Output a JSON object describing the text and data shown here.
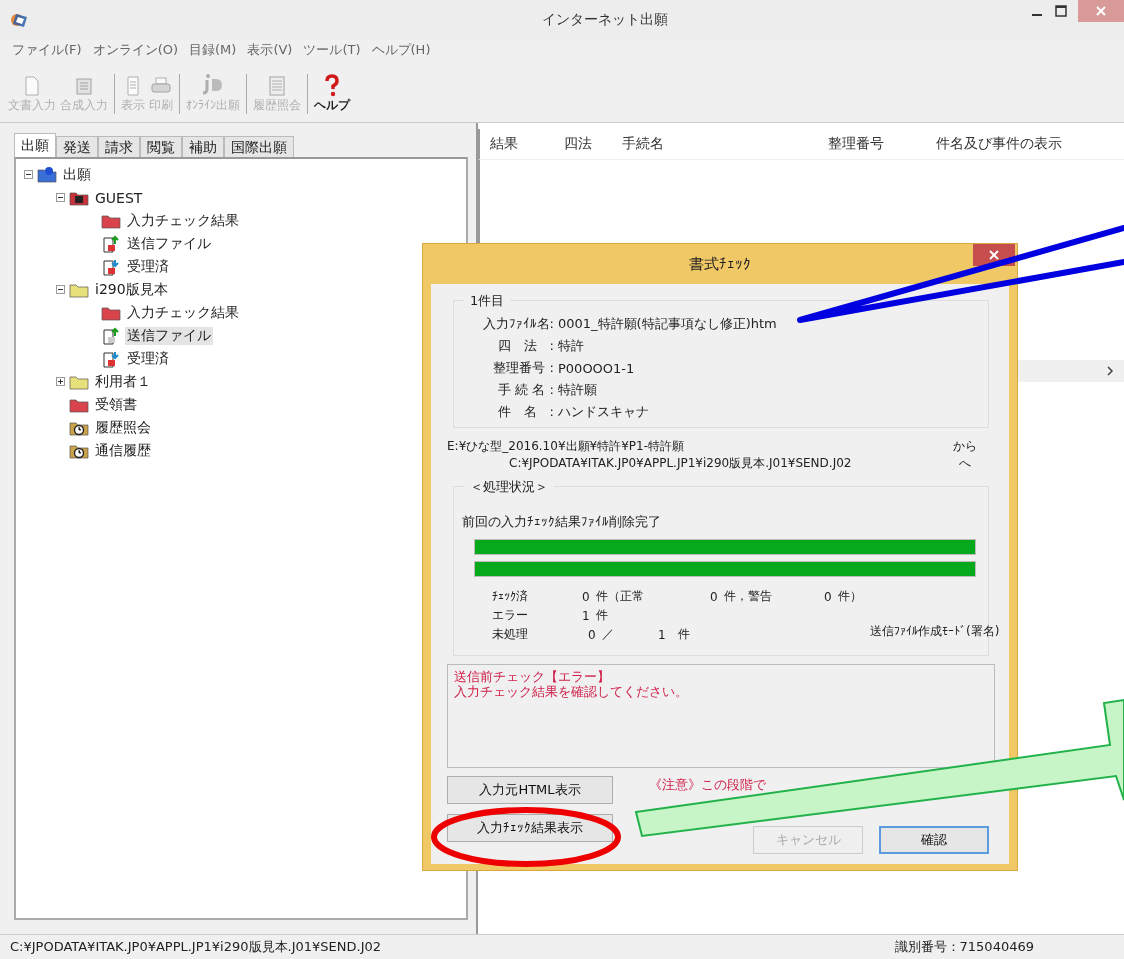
{
  "window": {
    "title": "インターネット出願"
  },
  "menu": [
    "ファイル(F)",
    "オンライン(O)",
    "目録(M)",
    "表示(V)",
    "ツール(T)",
    "ヘルプ(H)"
  ],
  "toolbar": [
    [
      {
        "label": "文書入力",
        "kind": "document",
        "disabled": true
      },
      {
        "label": "合成入力",
        "kind": "compose",
        "disabled": true
      }
    ],
    [
      {
        "label": "表示",
        "kind": "view",
        "disabled": true
      },
      {
        "label": "印刷",
        "kind": "print",
        "disabled": true
      }
    ],
    [
      {
        "label": "ｵﾝﾗｲﾝ出願",
        "kind": "online",
        "disabled": true
      }
    ],
    [
      {
        "label": "履歴照会",
        "kind": "history",
        "disabled": true
      }
    ],
    [
      {
        "label": "ヘルプ",
        "kind": "help",
        "disabled": false
      }
    ]
  ],
  "tabs": [
    {
      "label": "出願",
      "selected": true
    },
    {
      "label": "発送",
      "selected": false
    },
    {
      "label": "請求",
      "selected": false
    },
    {
      "label": "閲覧",
      "selected": false
    },
    {
      "label": "補助",
      "selected": false
    },
    {
      "label": "国際出願",
      "selected": false
    }
  ],
  "tree": [
    {
      "label": "出願",
      "kind": "root",
      "expanded": true,
      "selected": false,
      "children": [
        {
          "label": "GUEST",
          "kind": "user",
          "expanded": true,
          "selected": false,
          "children": [
            {
              "label": "入力チェック結果",
              "kind": "red-folder",
              "selected": false
            },
            {
              "label": "送信ファイル",
              "kind": "send",
              "selected": false
            },
            {
              "label": "受理済",
              "kind": "received",
              "selected": false
            }
          ]
        },
        {
          "label": "i290版見本",
          "kind": "folder",
          "expanded": true,
          "selected": false,
          "children": [
            {
              "label": "入力チェック結果",
              "kind": "red-folder",
              "selected": false
            },
            {
              "label": "送信ファイル",
              "kind": "send-active",
              "selected": true
            },
            {
              "label": "受理済",
              "kind": "received",
              "selected": false
            }
          ]
        },
        {
          "label": "利用者１",
          "kind": "folder",
          "expanded": false,
          "selected": false
        },
        {
          "label": "受領書",
          "kind": "red-folder",
          "selected": false
        },
        {
          "label": "履歴照会",
          "kind": "clock",
          "selected": false
        },
        {
          "label": "通信履歴",
          "kind": "clock",
          "selected": false
        }
      ]
    }
  ],
  "table": {
    "columns": [
      "結果",
      "四法",
      "手続名",
      "整理番号",
      "件名及び事件の表示"
    ]
  },
  "dialog": {
    "title": "書式ﾁｪｯｸ",
    "item_group": {
      "legend": "1件目",
      "fields": [
        {
          "label": "入力ﾌｧｲﾙ名:",
          "value": "0001_特許願(特記事項なし修正)htm"
        },
        {
          "label": "四　法　:",
          "value": "特許"
        },
        {
          "label": "整理番号 :",
          "value": "P00OOO1-1"
        },
        {
          "label": "手 続 名 :",
          "value": "特許願"
        },
        {
          "label": "件　名　:",
          "value": "ハンドスキャナ"
        }
      ]
    },
    "from_path": "E:¥ひな型_2016.10¥出願¥特許¥P1-特許願",
    "from_suffix": "から",
    "to_path": "C:¥JPODATA¥ITAK.JP0¥APPL.JP1¥i290版見本.J01¥SEND.J02",
    "to_suffix": "へ",
    "status_group": {
      "legend": "＜処理状況＞",
      "message": "前回の入力ﾁｪｯｸ結果ﾌｧｲﾙ削除完了",
      "progress": [
        {
          "level": 1
        },
        {
          "level": 1
        }
      ],
      "counts": [
        [
          "ﾁｪｯｸ済",
          "0",
          "件（正常",
          "0",
          "件，警告",
          "0",
          "件）"
        ],
        [
          "エラー",
          "1",
          "件"
        ],
        [
          "未処理",
          "0",
          "／",
          "1",
          "件"
        ]
      ],
      "mode": "送信ﾌｧｲﾙ作成ﾓｰﾄﾞ(署名)"
    },
    "messages": [
      "送信前チェック【エラー】",
      "入力チェック結果を確認してください。"
    ],
    "left_buttons": [
      "入力元HTML表示",
      "入力ﾁｪｯｸ結果表示"
    ],
    "note": "《注意》この段階で",
    "right_buttons": [
      {
        "label": "キャンセル",
        "disabled": true,
        "default": false
      },
      {
        "label": "確認",
        "disabled": false,
        "default": true
      }
    ]
  },
  "status_bar": {
    "path": "C:¥JPODATA¥ITAK.JP0¥APPL.JP1¥i290版見本.J01¥SEND.J02",
    "id": "識別番号：715040469"
  }
}
